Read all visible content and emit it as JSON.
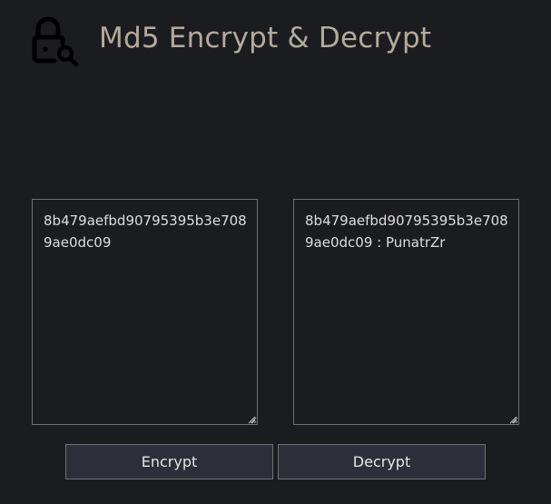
{
  "header": {
    "title": "Md5 Encrypt & Decrypt",
    "icon": "lock-search-icon"
  },
  "input": {
    "value": "8b479aefbd90795395b3e7089ae0dc09"
  },
  "output": {
    "value": "8b479aefbd90795395b3e7089ae0dc09 : PunatrZr"
  },
  "actions": {
    "encrypt_label": "Encrypt",
    "decrypt_label": "Decrypt"
  },
  "colors": {
    "background": "#1b1c1f",
    "title": "#b3aa9c",
    "button_bg": "#2c2f39",
    "border": "#6f7075",
    "text": "#dedede"
  }
}
